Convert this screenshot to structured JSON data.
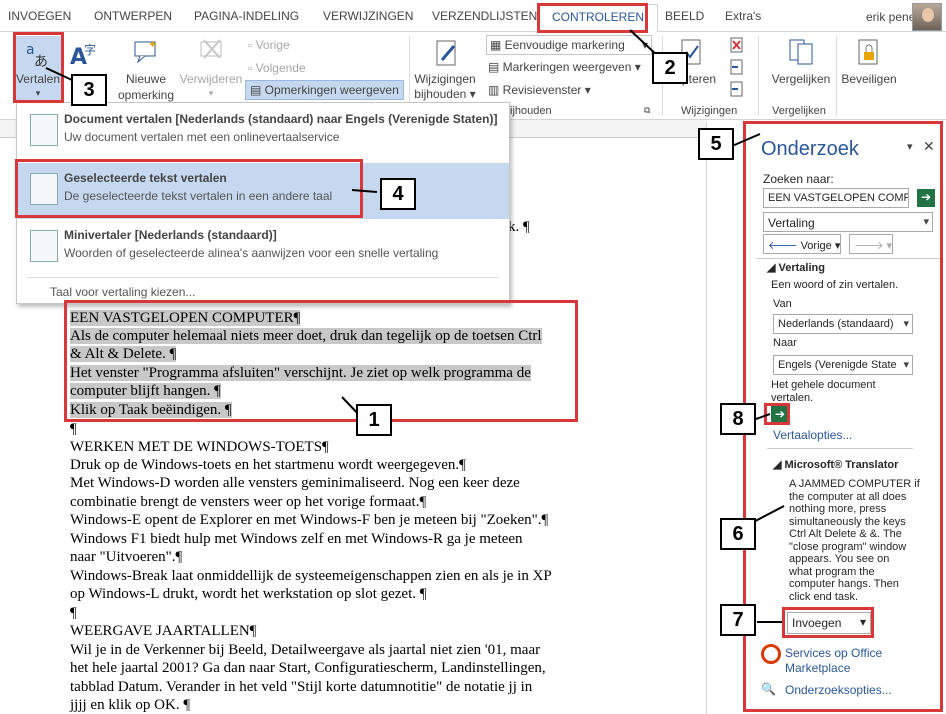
{
  "tabs": [
    "INVOEGEN",
    "ONTWERPEN",
    "PAGINA-INDELING",
    "VERWIJZINGEN",
    "VERZENDLIJSTEN",
    "CONTROLEREN",
    "BEELD",
    "Extra's"
  ],
  "user": "erik penen",
  "ribbon": {
    "translate": "Vertalen",
    "new_comment": [
      "Nieuwe",
      "opmerking"
    ],
    "delete": "Verwijderen",
    "previous": "Vorige",
    "next": "Volgende",
    "show_comments": "Opmerkingen weergeven",
    "track_changes": [
      "Wijzigingen",
      "bijhouden"
    ],
    "markup_select": "Eenvoudige markering",
    "show_markup": "Markeringen weergeven",
    "review_pane": "Revisievenster",
    "group_tracking": "ijhouden",
    "accept": "pteren",
    "group_changes": "Wijzigingen",
    "compare": "Vergelijken",
    "group_compare": "Vergelijken",
    "protect": "Beveiligen"
  },
  "menu": {
    "items": [
      {
        "title": "Document vertalen [Nederlands (standaard) naar Engels (Verenigde Staten)]",
        "desc": "Uw document vertalen met een onlinevertaalservice"
      },
      {
        "title": "Geselecteerde tekst vertalen",
        "desc": "De geselecteerde tekst vertalen in een andere taal"
      },
      {
        "title": "Minivertaler [Nederlands (standaard)]",
        "desc": "Woorden of geselecteerde alinea's aanwijzen voor een snelle vertaling"
      }
    ],
    "footer": "Taal voor vertaling kiezen..."
  },
  "document": {
    "trail": "k. ¶",
    "lines": [
      "EEN VASTGELOPEN COMPUTER¶",
      "Als de computer helemaal niets meer doet, druk dan tegelijk op de toetsen Ctrl",
      "& Alt & Delete. ¶",
      "Het venster \"Programma afsluiten\" verschijnt. Je ziet op welk programma de",
      "computer blijft hangen. ¶",
      "Klik op Taak beëindigen. ¶",
      "¶",
      "WERKEN MET DE WINDOWS-TOETS¶",
      "Druk op de Windows-toets en het startmenu wordt weergegeven.¶",
      "Met Windows-D worden alle vensters geminimaliseerd. Nog een keer deze",
      "combinatie brengt de vensters weer op het vorige formaat.¶",
      "Windows-E opent de Explorer en met Windows-F ben je meteen bij \"Zoeken\".¶",
      "Windows F1 biedt hulp met Windows zelf en met Windows-R ga je meteen",
      "naar \"Uitvoeren\".¶",
      "Windows-Break laat onmiddellijk de systeemeigenschappen zien en als je in XP",
      "op Windows-L drukt, wordt het werkstation op slot gezet. ¶",
      "¶",
      "WEERGAVE JAARTALLEN¶",
      "Wil je in de Verkenner bij Beeld, Detailweergave als jaartal niet zien '01, maar",
      "het hele jaartal 2001? Ga dan naar Start, Configuratiescherm, Landinstellingen,",
      "tabblad Datum. Verander in het veld \"Stijl korte datumnotitie\" de notatie jj in",
      "jjjj en klik op OK. ¶"
    ]
  },
  "pane": {
    "title": "Onderzoek",
    "search_label": "Zoeken naar:",
    "search_value": "EEN VASTGELOPEN COMPU",
    "service": "Vertaling",
    "back": "Vorige",
    "section": "Vertaling",
    "hint": "Een woord of zin vertalen.",
    "from_label": "Van",
    "from_value": "Nederlands (standaard)",
    "to_label": "Naar",
    "to_value": "Engels (Verenigde State",
    "whole_doc": [
      "Het gehele document",
      "vertalen."
    ],
    "options_link": "Vertaalopties...",
    "translator_title": "Microsoft® Translator",
    "result": [
      "A JAMMED COMPUTER if",
      "the computer at all does",
      "nothing more, press",
      "simultaneously the keys",
      "Ctrl Alt Delete & &.  The",
      "\"close program\" window",
      "appears. You see on",
      "what program the",
      "computer hangs.  Then",
      "click end task."
    ],
    "insert": "Invoegen",
    "services_link": [
      "Services op Office",
      "Marketplace"
    ],
    "research_options": "Onderzoeksopties..."
  },
  "callouts": [
    "1",
    "2",
    "3",
    "4",
    "5",
    "6",
    "7",
    "8"
  ],
  "colors": {
    "accent": "#2b579a",
    "callout_red": "#d9383a",
    "menu_selected": "#c5d8ef",
    "go_green": "#217346"
  }
}
